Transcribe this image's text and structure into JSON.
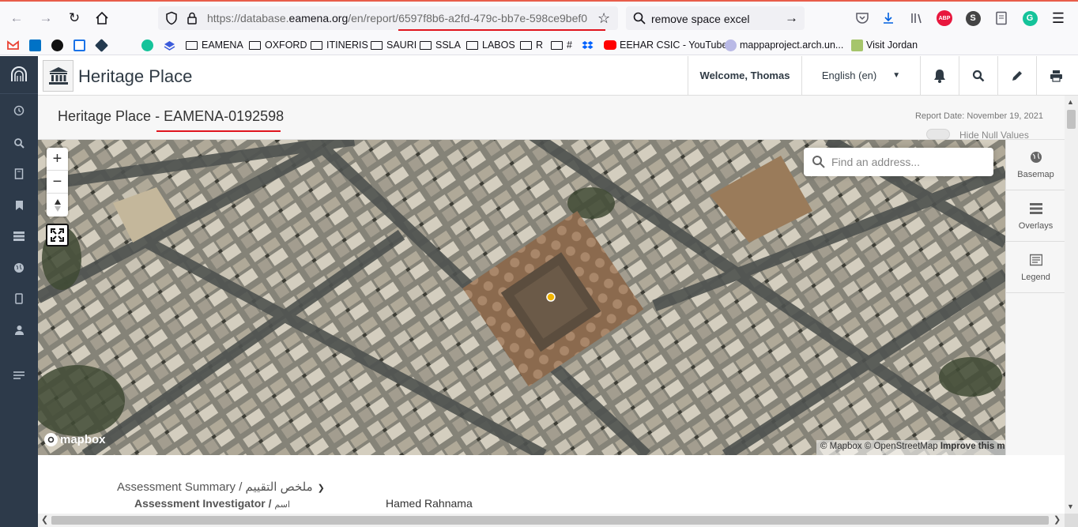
{
  "browser": {
    "url_prefix": "https://database.",
    "url_domain": "eamena.org",
    "url_path": "/en/report/6597f8b6-a2fd-479c-bb7e-598ce9bef0",
    "search_text": "remove space excel",
    "bookmarks": [
      {
        "label": "",
        "icon": "gmail-icon",
        "color": "#ea4335"
      },
      {
        "label": "",
        "icon": "outlook-icon",
        "color": "#0072c6"
      },
      {
        "label": "",
        "icon": "github-icon",
        "color": "#111111"
      },
      {
        "label": "",
        "icon": "calendar-icon",
        "color": "#1a73e8"
      },
      {
        "label": "",
        "icon": "diamond-icon",
        "color": "#233a4f"
      },
      {
        "label": "",
        "icon": "grammarly-icon",
        "color": "#15c39a"
      },
      {
        "label": "",
        "icon": "layers-icon",
        "color": "#3b5bdb"
      },
      {
        "label": "EAMENA",
        "icon": "folder-icon"
      },
      {
        "label": "OXFORD",
        "icon": "folder-icon"
      },
      {
        "label": "ITINERIS",
        "icon": "folder-icon"
      },
      {
        "label": "SAURI",
        "icon": "folder-icon"
      },
      {
        "label": "SSLA",
        "icon": "folder-icon"
      },
      {
        "label": "LABOS",
        "icon": "folder-icon"
      },
      {
        "label": "R",
        "icon": "folder-icon"
      },
      {
        "label": "#",
        "icon": "folder-icon"
      },
      {
        "label": "",
        "icon": "dropbox-icon",
        "color": "#0061fe"
      },
      {
        "label": "EEHAR CSIC - YouTube",
        "icon": "youtube-icon",
        "color": "#ff0000"
      },
      {
        "label": "mappaproject.arch.un...",
        "icon": "globe-icon",
        "color": "#7a7acd"
      },
      {
        "label": "Visit Jordan",
        "icon": "jordan-icon",
        "color": "#7aa33a"
      }
    ]
  },
  "app": {
    "title": "Heritage Place",
    "welcome": "Welcome, Thomas",
    "language": "English (en)"
  },
  "report": {
    "title_prefix": "Heritage Place - ",
    "title_id": "EAMENA-0192598",
    "date": "Report Date: November 19, 2021",
    "hide_null_label": "Hide Null Values"
  },
  "map": {
    "search_placeholder": "Find an address...",
    "logo_text": "mapbox",
    "attribution_mapbox": "© Mapbox",
    "attribution_osm": "© OpenStreetMap",
    "attribution_improve": "Improve this map",
    "tools": [
      {
        "label": "Basemap",
        "icon": "globe-icon"
      },
      {
        "label": "Overlays",
        "icon": "list-icon"
      },
      {
        "label": "Legend",
        "icon": "legend-icon"
      }
    ]
  },
  "assessment": {
    "summary_label": "Assessment Summary / ملخص التقييم",
    "investigator_label": "Assessment Investigator / ",
    "investigator_label_ar": "اسم",
    "investigator_value": "Hamed Rahnama"
  }
}
